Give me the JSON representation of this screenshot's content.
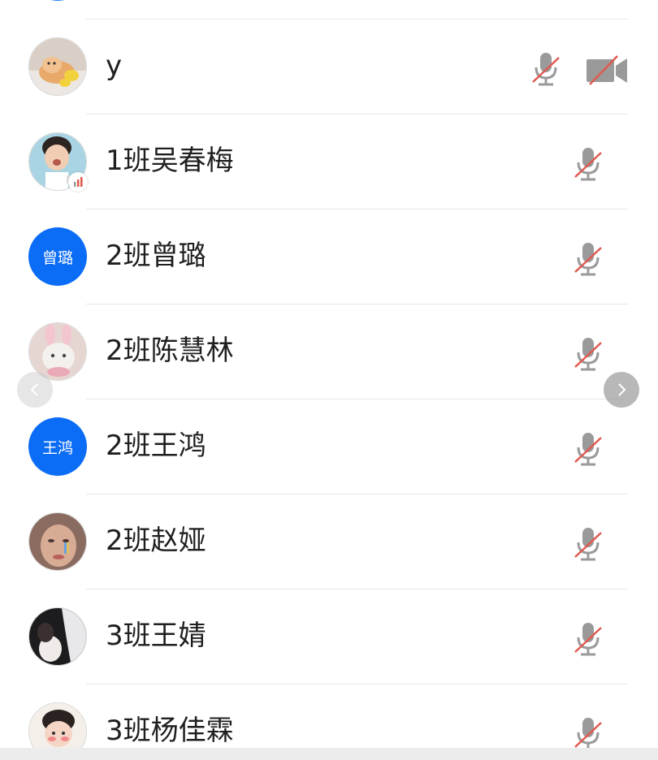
{
  "participants": [
    {
      "name": "",
      "avatar_type": "plain"
    },
    {
      "name": "y",
      "avatar_type": "photo",
      "avatar_icon": "shiba-dog-photo",
      "mic_muted": true,
      "camera_off": true
    },
    {
      "name": "1班吴春梅",
      "avatar_type": "photo",
      "avatar_icon": "child-photo",
      "mic_muted": true,
      "speaking_badge": true
    },
    {
      "name": "2班曾璐",
      "avatar_type": "text",
      "avatar_text": "曾璐",
      "mic_muted": true
    },
    {
      "name": "2班陈慧林",
      "avatar_type": "photo",
      "avatar_icon": "cat-bunny-ears-photo",
      "mic_muted": true
    },
    {
      "name": "2班王鸿",
      "avatar_type": "text",
      "avatar_text": "王鸿",
      "mic_muted": true
    },
    {
      "name": "2班赵娅",
      "avatar_type": "photo",
      "avatar_icon": "face-rainbow-tears-photo",
      "mic_muted": true
    },
    {
      "name": "3班王婧",
      "avatar_type": "photo",
      "avatar_icon": "dark-photo",
      "mic_muted": true
    },
    {
      "name": "3班杨佳霖",
      "avatar_type": "photo",
      "avatar_icon": "cartoon-boy-photo",
      "mic_muted": true
    }
  ],
  "colors": {
    "text_avatar_bg": "#0b6cf5",
    "muted_slash": "#e05a4f",
    "icon_gray": "#9a9a9a",
    "divider": "#e6e6e6"
  },
  "nav": {
    "prev_icon": "chevron-left-icon",
    "next_icon": "chevron-right-icon"
  }
}
